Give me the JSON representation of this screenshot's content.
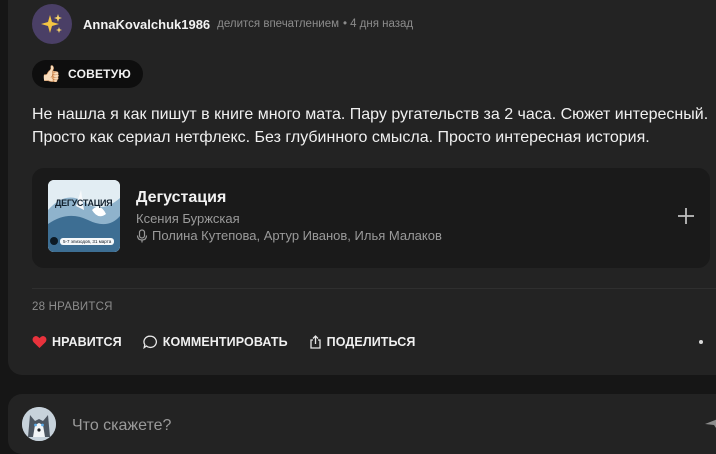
{
  "post": {
    "author": "AnnaKovalchuk1986",
    "action_text": "делится впечатлением",
    "separator": "•",
    "time": "4 дня назад",
    "avatar_icon": "sparkles-icon",
    "badge": {
      "emoji": "👍🏻",
      "label": "СОВЕТУЮ"
    },
    "text": "Не нашла я как пишут в книге много мата. Пару ругательств за 2 часа. Сюжет интересный. Просто как сериал нетфлекс. Без глубинного смысла. Просто интересная история."
  },
  "book": {
    "title": "Дегустация",
    "author": "Ксения Буржская",
    "narrators": "Полина Кутепова, Артур Иванов, Илья Малаков",
    "cover_title": "ДЕГУСТАЦИЯ",
    "cover_info": "5-7 эпизодов, 31 марта",
    "add_icon": "plus-icon"
  },
  "stats": {
    "likes_label": "28 НРАВИТСЯ"
  },
  "actions": {
    "like": "НРАВИТСЯ",
    "comment": "КОММЕНТИРОВАТЬ",
    "share": "ПОДЕЛИТЬСЯ"
  },
  "comment": {
    "placeholder": "Что скажете?"
  },
  "colors": {
    "background": "#161616",
    "card": "#232323",
    "like_heart": "#e8323c",
    "avatar_bg": "#4a3f66",
    "sparkle": "#f5c542"
  }
}
